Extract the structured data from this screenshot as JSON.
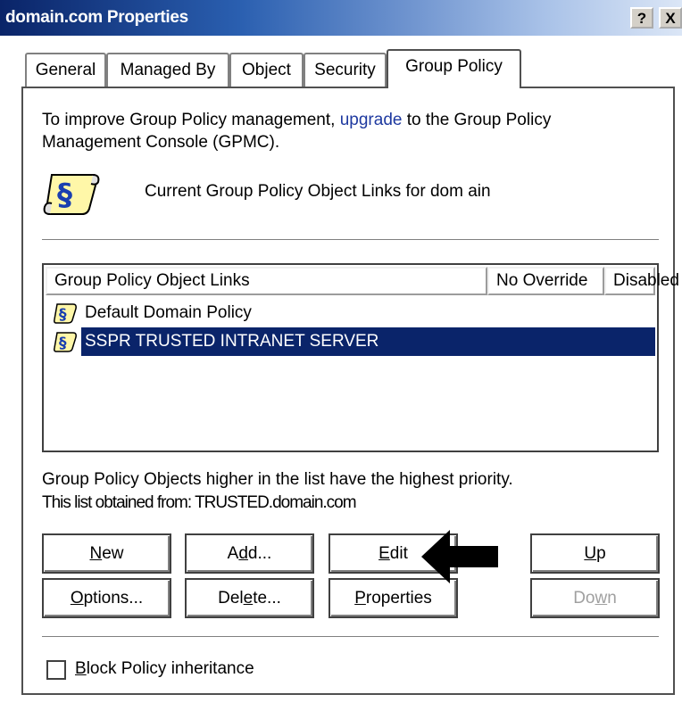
{
  "window": {
    "title": "domain.com Properties",
    "help_label": "?",
    "close_label": "X"
  },
  "tabs": [
    {
      "label": "General",
      "active": false
    },
    {
      "label": "Managed By",
      "active": false
    },
    {
      "label": "Object",
      "active": false
    },
    {
      "label": "Security",
      "active": false
    },
    {
      "label": "Group Policy",
      "active": true
    }
  ],
  "info": {
    "line1_prefix": "To improve Group Policy management, ",
    "link": "upgrade",
    "line1_suffix": " to the Group Policy",
    "line2": "Management Console (GPMC).",
    "heading": "Current Group Policy Object Links for dom ain"
  },
  "list": {
    "columns": [
      "Group Policy Object Links",
      "No Override",
      "Disabled"
    ],
    "rows": [
      {
        "name": "Default Domain Policy",
        "selected": false
      },
      {
        "name": "SSPR TRUSTED INTRANET SERVER",
        "selected": true
      }
    ]
  },
  "notes": {
    "priority": "Group Policy Objects higher in the list have the highest priority.",
    "obtained": "This list obtained from: TRUSTED.domain.com"
  },
  "buttons": {
    "new": {
      "pre": "",
      "key": "N",
      "post": "ew",
      "enabled": true
    },
    "add": {
      "pre": "A",
      "key": "d",
      "post": "d...",
      "enabled": true
    },
    "edit": {
      "pre": "",
      "key": "E",
      "post": "dit",
      "enabled": true
    },
    "up": {
      "pre": "",
      "key": "U",
      "post": "p",
      "enabled": true
    },
    "options": {
      "pre": "",
      "key": "O",
      "post": "ptions...",
      "enabled": true
    },
    "delete": {
      "pre": "Del",
      "key": "e",
      "post": "te...",
      "enabled": true
    },
    "properties": {
      "pre": "",
      "key": "P",
      "post": "roperties",
      "enabled": true
    },
    "down": {
      "pre": "Do",
      "key": "w",
      "post": "n",
      "enabled": false
    }
  },
  "block_inheritance": {
    "pre": "",
    "key": "B",
    "post": "lock Policy inheritance",
    "checked": false
  },
  "colors": {
    "selection": "#0a246a",
    "link": "#1f3aa0",
    "titlebar_start": "#0a2468"
  },
  "icons": [
    "scroll-policy-icon",
    "arrow-pointer-icon"
  ]
}
